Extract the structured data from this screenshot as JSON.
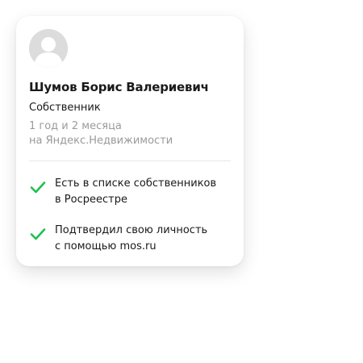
{
  "owner_card": {
    "avatar_icon": "user-silhouette-icon",
    "name": "Шумов Борис Валериевич",
    "role": "Собственник",
    "duration_line1": "1 год и 2 месяца",
    "duration_line2": "на Яндекс.Недвижимости",
    "verifications": [
      {
        "icon": "check-icon",
        "line1": "Есть в списке собственников",
        "line2": "в Росреестре"
      },
      {
        "icon": "check-icon",
        "line1": "Подтвердил свою личность",
        "line2": "с помощью mos.ru"
      }
    ],
    "colors": {
      "check": "#1fbf4f",
      "muted_text": "#9a9a9a",
      "avatar_bg": "#dcdcdc"
    }
  }
}
